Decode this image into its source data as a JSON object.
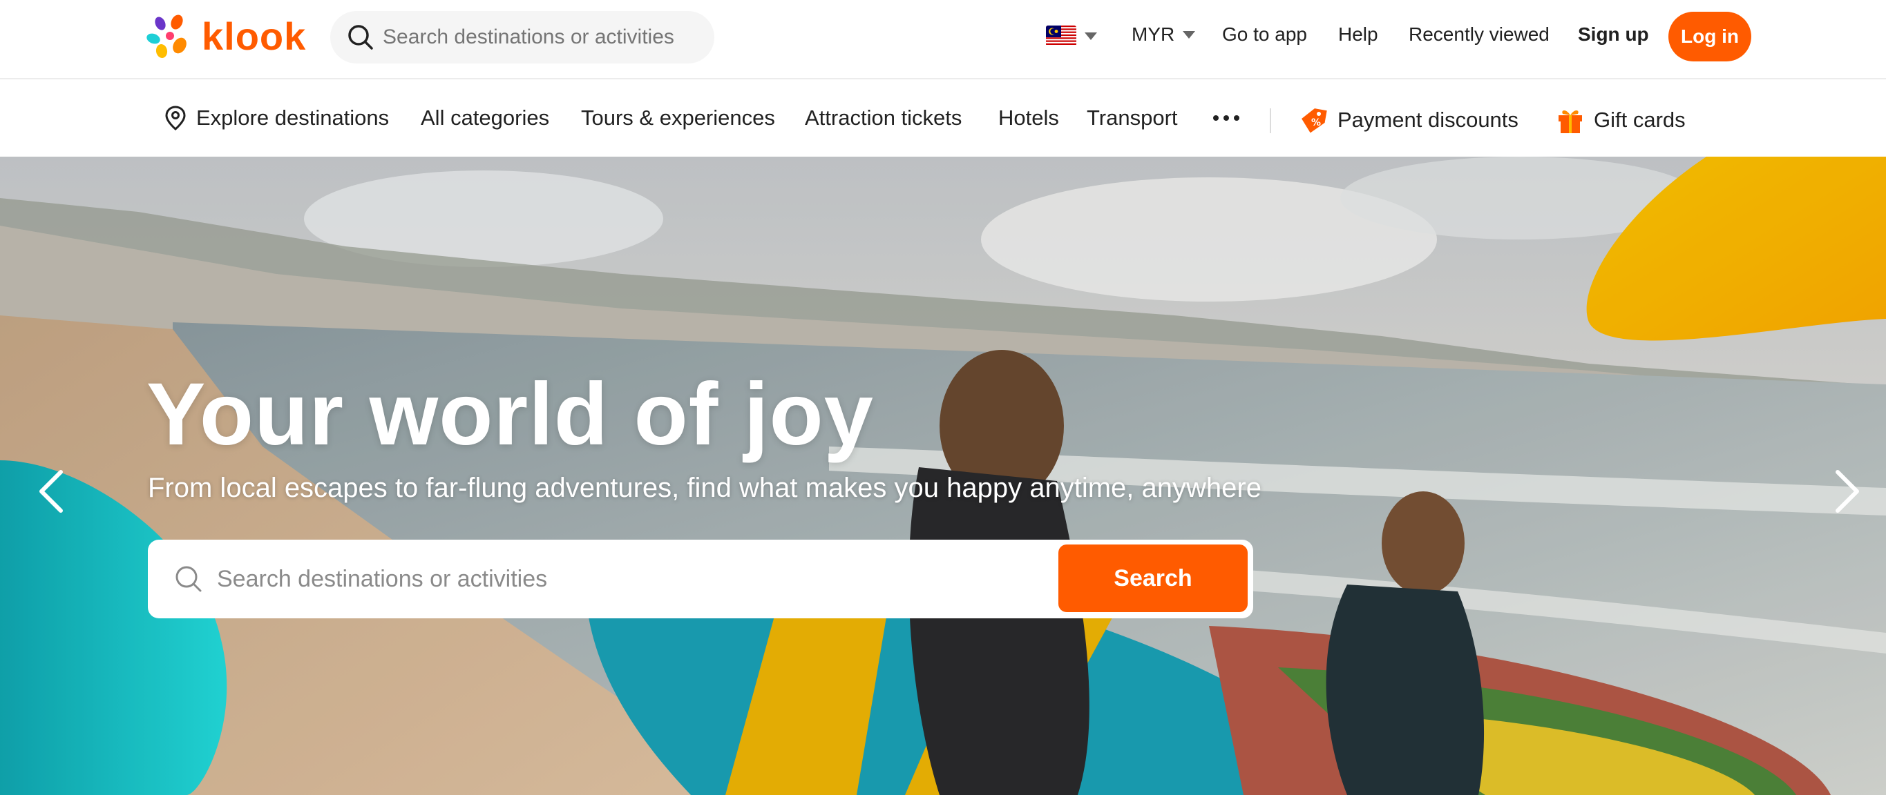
{
  "header": {
    "brand": "klook",
    "search_placeholder": "Search destinations or activities",
    "currency": "MYR",
    "links": {
      "go_to_app": "Go to app",
      "help": "Help",
      "recently_viewed": "Recently viewed",
      "sign_up": "Sign up",
      "log_in": "Log in"
    },
    "flag_icon": "malaysia-flag-icon"
  },
  "nav": {
    "explore": "Explore destinations",
    "all_categories": "All categories",
    "tours": "Tours & experiences",
    "attraction": "Attraction tickets",
    "hotels": "Hotels",
    "transport": "Transport",
    "payment_discounts": "Payment discounts",
    "gift_cards": "Gift cards"
  },
  "hero": {
    "title": "Your world of joy",
    "subtitle": "From local escapes to far-flung adventures, find what makes you happy anytime, anywhere",
    "search_placeholder": "Search destinations or activities",
    "search_button": "Search"
  },
  "colors": {
    "brand": "#ff5b00",
    "accent_yellow": "#ffbd00",
    "accent_teal": "#1ecfd6"
  }
}
